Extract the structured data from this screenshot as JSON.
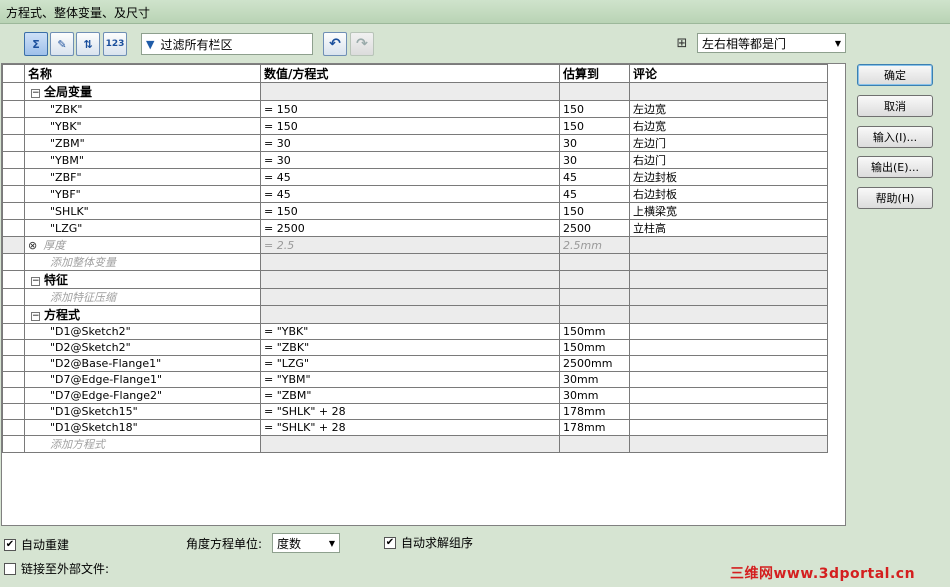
{
  "window": {
    "title": "方程式、整体变量、及尺寸"
  },
  "toolbar": {
    "filter_placeholder": "过滤所有栏区",
    "view_mode_selected": "左右相等都是门",
    "btn_equations_view": "Σ",
    "btn_sketch_view": "✎",
    "btn_dim_view": "⇅",
    "btn_order_view": "123"
  },
  "grid": {
    "headers": [
      "名称",
      "数值/方程式",
      "估算到",
      "评论"
    ],
    "global_section": "全局变量",
    "globals": [
      {
        "name": "\"ZBK\"",
        "value": "= 150",
        "est": "150",
        "comment": "左边宽"
      },
      {
        "name": "\"YBK\"",
        "value": "= 150",
        "est": "150",
        "comment": "右边宽"
      },
      {
        "name": "\"ZBM\"",
        "value": "= 30",
        "est": "30",
        "comment": "左边门"
      },
      {
        "name": "\"YBM\"",
        "value": "= 30",
        "est": "30",
        "comment": "右边门"
      },
      {
        "name": "\"ZBF\"",
        "value": "= 45",
        "est": "45",
        "comment": "左边封板"
      },
      {
        "name": "\"YBF\"",
        "value": "= 45",
        "est": "45",
        "comment": "右边封板"
      },
      {
        "name": "\"SHLK\"",
        "value": "= 150",
        "est": "150",
        "comment": "上横梁宽"
      },
      {
        "name": "\"LZG\"",
        "value": "= 2500",
        "est": "2500",
        "comment": "立柱高"
      }
    ],
    "thickness": {
      "name": "厚度",
      "value": "= 2.5",
      "est": "2.5mm"
    },
    "add_global": "添加整体变量",
    "feature_section": "特征",
    "add_feature": "添加特征压缩",
    "equation_section": "方程式",
    "equations": [
      {
        "name": "\"D1@Sketch2\"",
        "value": "= \"YBK\"",
        "est": "150mm"
      },
      {
        "name": "\"D2@Sketch2\"",
        "value": "= \"ZBK\"",
        "est": "150mm"
      },
      {
        "name": "\"D2@Base-Flange1\"",
        "value": "= \"LZG\"",
        "est": "2500mm"
      },
      {
        "name": "\"D7@Edge-Flange1\"",
        "value": "= \"YBM\"",
        "est": "30mm"
      },
      {
        "name": "\"D7@Edge-Flange2\"",
        "value": "= \"ZBM\"",
        "est": "30mm"
      },
      {
        "name": "\"D1@Sketch15\"",
        "value": "= \"SHLK\" + 28",
        "est": "178mm"
      },
      {
        "name": "\"D1@Sketch18\"",
        "value": "= \"SHLK\" + 28",
        "est": "178mm"
      }
    ],
    "add_equation": "添加方程式"
  },
  "buttons": {
    "ok": "确定",
    "cancel": "取消",
    "import": "输入(I)...",
    "export": "输出(E)...",
    "help": "帮助(H)"
  },
  "bottom": {
    "auto_rebuild": "自动重建",
    "auto_rebuild_checked": true,
    "angle_unit_label": "角度方程单位:",
    "angle_unit_value": "度数",
    "auto_solve": "自动求解组序",
    "auto_solve_checked": true,
    "link_external": "链接至外部文件:",
    "link_external_checked": false
  },
  "watermark": "三维网www.3dportal.cn"
}
